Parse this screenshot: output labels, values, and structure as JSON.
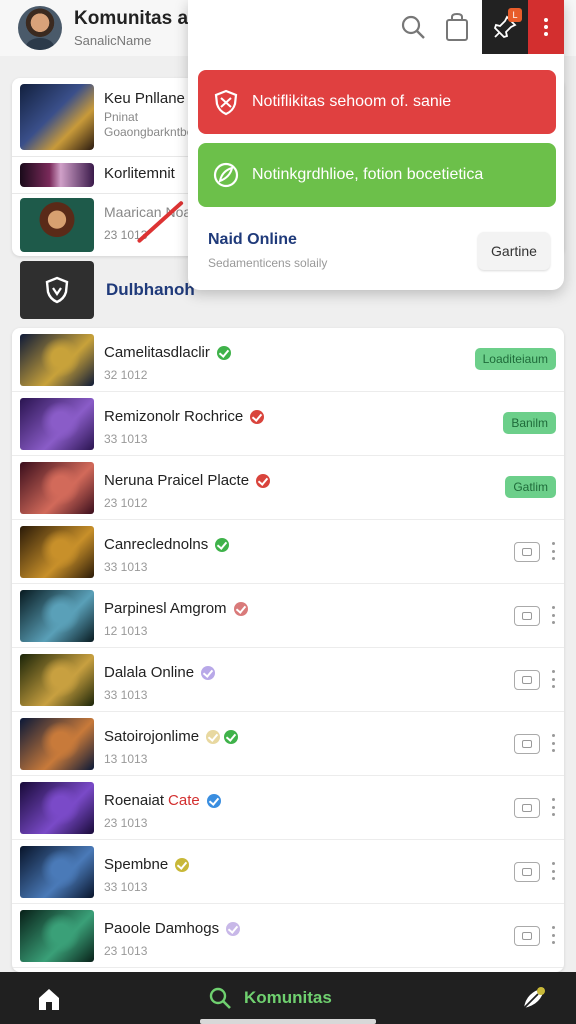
{
  "header": {
    "title": "Komunitas a",
    "subtitle": "SanalicName"
  },
  "top_list": [
    {
      "title": "Keu Pnllane",
      "sub1": "Pninat",
      "sub2": "Goaongbarkntbo"
    },
    {
      "title": "Korlitemnit",
      "sub1": "",
      "sub2": ""
    },
    {
      "title": "Maarican Noa",
      "sub1": "",
      "sub2": "23 1013"
    }
  ],
  "section": {
    "title": "Dulbhanoh"
  },
  "popup": {
    "notifications": [
      {
        "text": "Notiflikitas sehoom of. sanie",
        "color": "#e04040",
        "icon": "shield-icon"
      },
      {
        "text": "Notinkgrdhlioe, fotion bocetietica",
        "color": "#6cc04a",
        "icon": "leaf-check-icon"
      }
    ],
    "title": "Naid Online",
    "subtitle": "Sedamenticens solaily",
    "button_label": "Gartine"
  },
  "games": [
    {
      "title": "Camelitasdlaclir",
      "sub": "32 1012",
      "dots": [
        "#3fb24a"
      ],
      "action": "tag",
      "tag": "Loaditeiaum",
      "thumb": [
        "#0e1a38",
        "#c8a23a"
      ]
    },
    {
      "title": "Remizonolr Rochrice",
      "sub": "33 1013",
      "dots": [
        "#d9443c"
      ],
      "action": "tag",
      "tag": "Banilm",
      "thumb": [
        "#2a1450",
        "#8a5cc8"
      ]
    },
    {
      "title": "Neruna Praicel Placte",
      "sub": "23 1012",
      "dots": [
        "#d9443c"
      ],
      "action": "tag",
      "tag": "Gatlim",
      "thumb": [
        "#3a0e1c",
        "#d26a5a"
      ]
    },
    {
      "title": "Canreclednolns",
      "sub": "33 1013",
      "dots": [
        "#3fb24a"
      ],
      "action": "button",
      "thumb": [
        "#2a1a08",
        "#c8902a"
      ]
    },
    {
      "title": "Parpinesl Amgrom",
      "sub": "12 1013",
      "dots": [
        "#d97a7a"
      ],
      "action": "button",
      "thumb": [
        "#081a20",
        "#5aa0b8"
      ]
    },
    {
      "title": "Dalala Online",
      "sub": "33 1013",
      "dots": [
        "#b8a8e8"
      ],
      "action": "button",
      "thumb": [
        "#1a2408",
        "#c8a040"
      ]
    },
    {
      "title": "Satoirojonlime",
      "sub": "13 1013",
      "dots": [
        "#e8d8a0",
        "#3fb24a"
      ],
      "action": "button",
      "thumb": [
        "#0a1838",
        "#c87a3a"
      ]
    },
    {
      "title": "Roenaiat",
      "highlight": "Cate",
      "sub": "23 1013",
      "dots": [
        "#3a8ee0"
      ],
      "action": "button",
      "thumb": [
        "#180a38",
        "#7a4ac8"
      ]
    },
    {
      "title": "Spembne",
      "sub": "33 1013",
      "dots": [
        "#c8b838"
      ],
      "action": "button",
      "thumb": [
        "#08142a",
        "#4a7ab8"
      ]
    },
    {
      "title": "Paoole Damhogs",
      "sub": "23 1013",
      "dots": [
        "#c8b8e8"
      ],
      "action": "button",
      "thumb": [
        "#082018",
        "#3aa078"
      ]
    }
  ],
  "bottom_nav": {
    "center_label": "Komunitas"
  }
}
